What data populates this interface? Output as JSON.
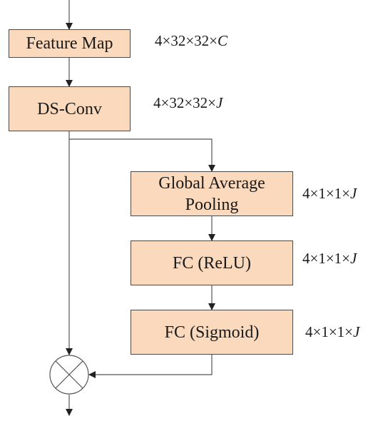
{
  "diagram": {
    "nodes": [
      {
        "id": "feature_map",
        "label": "Feature Map",
        "dim_prefix": "4×32×32×",
        "dim_var": "C"
      },
      {
        "id": "ds_conv",
        "label": "DS-Conv",
        "dim_prefix": "4×32×32×",
        "dim_var": "J"
      },
      {
        "id": "gap",
        "label_line1": "Global Average",
        "label_line2": "Pooling",
        "dim_prefix": "4×1×1×",
        "dim_var": "J"
      },
      {
        "id": "fc_relu",
        "label": "FC (ReLU)",
        "dim_prefix": "4×1×1×",
        "dim_var": "J"
      },
      {
        "id": "fc_sigmoid",
        "label": "FC (Sigmoid)",
        "dim_prefix": "4×1×1×",
        "dim_var": "J"
      }
    ],
    "operator": {
      "id": "multiply",
      "symbol": "multiply-circle-icon"
    },
    "colors": {
      "box_fill": "#fad9bd",
      "box_border": "#4a4a4a",
      "line": "#555555"
    },
    "edges": [
      [
        "input",
        "feature_map"
      ],
      [
        "feature_map",
        "ds_conv"
      ],
      [
        "ds_conv",
        "gap"
      ],
      [
        "gap",
        "fc_relu"
      ],
      [
        "fc_relu",
        "fc_sigmoid"
      ],
      [
        "ds_conv",
        "multiply"
      ],
      [
        "fc_sigmoid",
        "multiply"
      ],
      [
        "multiply",
        "output"
      ]
    ]
  }
}
